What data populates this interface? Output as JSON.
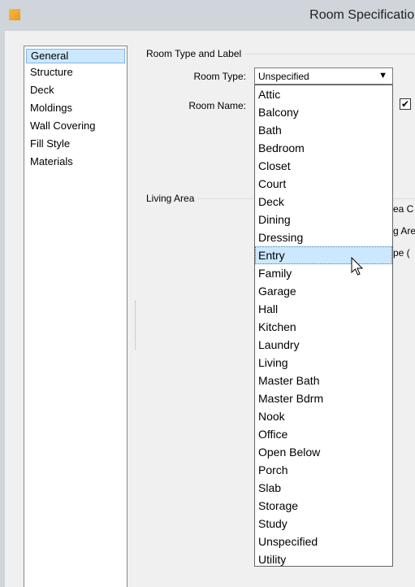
{
  "window": {
    "title": "Room Specification"
  },
  "nav": {
    "items": [
      "General",
      "Structure",
      "Deck",
      "Moldings",
      "Wall Covering",
      "Fill Style",
      "Materials"
    ],
    "selected": "General"
  },
  "room_type_group": {
    "label": "Room Type and Label",
    "room_type_label": "Room Type:",
    "room_type_value": "Unspecified",
    "room_name_label": "Room Name:",
    "checkbox_mark": "✔"
  },
  "living_area_group": {
    "label": "Living Area",
    "clipped": [
      "ea C",
      "g Are",
      "pe ("
    ]
  },
  "dropdown": {
    "options": [
      "Attic",
      "Balcony",
      "Bath",
      "Bedroom",
      "Closet",
      "Court",
      "Deck",
      "Dining",
      "Dressing",
      "Entry",
      "Family",
      "Garage",
      "Hall",
      "Kitchen",
      "Laundry",
      "Living",
      "Master Bath",
      "Master Bdrm",
      "Nook",
      "Office",
      "Open Below",
      "Porch",
      "Slab",
      "Storage",
      "Study",
      "Unspecified",
      "Utility"
    ],
    "hovered": "Entry"
  },
  "colors": {
    "selection": "#cce8ff",
    "titlebar": "#cfd5da"
  }
}
